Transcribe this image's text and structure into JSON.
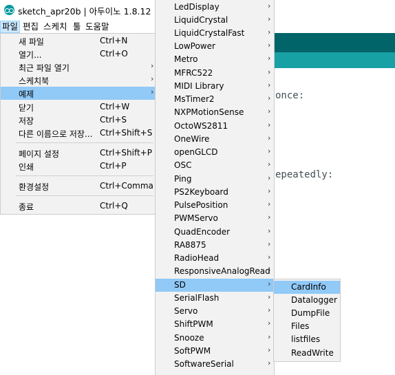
{
  "window": {
    "title": "sketch_apr20b | 아두이노 1.8.12"
  },
  "menubar": {
    "items": [
      {
        "label": "파일",
        "active": true
      },
      {
        "label": "편집"
      },
      {
        "label": "스케치"
      },
      {
        "label": "툴"
      },
      {
        "label": "도움말"
      }
    ]
  },
  "file_menu": {
    "items": [
      {
        "label": "새 파일",
        "shortcut": "Ctrl+N"
      },
      {
        "label": "열기...",
        "shortcut": "Ctrl+O"
      },
      {
        "label": "최근 파일 열기",
        "submenu": true
      },
      {
        "label": "스케치북",
        "submenu": true
      },
      {
        "label": "예제",
        "submenu": true,
        "selected": true
      },
      {
        "label": "닫기",
        "shortcut": "Ctrl+W"
      },
      {
        "label": "저장",
        "shortcut": "Ctrl+S"
      },
      {
        "label": "다른 이름으로 저장...",
        "shortcut": "Ctrl+Shift+S"
      },
      {
        "label": "페이지 설정",
        "shortcut": "Ctrl+Shift+P"
      },
      {
        "label": "인쇄",
        "shortcut": "Ctrl+P"
      },
      {
        "label": "환경설정",
        "shortcut": "Ctrl+Comma"
      },
      {
        "label": "종료",
        "shortcut": "Ctrl+Q"
      }
    ]
  },
  "examples_menu": {
    "items": [
      {
        "label": "LedDisplay"
      },
      {
        "label": "LiquidCrystal"
      },
      {
        "label": "LiquidCrystalFast"
      },
      {
        "label": "LowPower"
      },
      {
        "label": "Metro"
      },
      {
        "label": "MFRC522"
      },
      {
        "label": "MIDI Library"
      },
      {
        "label": "MsTimer2"
      },
      {
        "label": "NXPMotionSense"
      },
      {
        "label": "OctoWS2811"
      },
      {
        "label": "OneWire"
      },
      {
        "label": "openGLCD"
      },
      {
        "label": "OSC"
      },
      {
        "label": "Ping"
      },
      {
        "label": "PS2Keyboard"
      },
      {
        "label": "PulsePosition"
      },
      {
        "label": "PWMServo"
      },
      {
        "label": "QuadEncoder"
      },
      {
        "label": "RA8875"
      },
      {
        "label": "RadioHead"
      },
      {
        "label": "ResponsiveAnalogRead"
      },
      {
        "label": "SD",
        "selected": true
      },
      {
        "label": "SerialFlash"
      },
      {
        "label": "Servo"
      },
      {
        "label": "ShiftPWM"
      },
      {
        "label": "Snooze"
      },
      {
        "label": "SoftPWM"
      },
      {
        "label": "SoftwareSerial"
      }
    ]
  },
  "sd_menu": {
    "items": [
      {
        "label": "CardInfo",
        "selected": true
      },
      {
        "label": "Datalogger"
      },
      {
        "label": "DumpFile"
      },
      {
        "label": "Files"
      },
      {
        "label": "listfiles"
      },
      {
        "label": "ReadWrite"
      }
    ]
  },
  "editor": {
    "code_fragments": [
      "once:",
      "epeatedly:"
    ]
  },
  "colors": {
    "toolbar": "#006468",
    "tabs": "#17a1a5",
    "menu_bg": "#f2f2f2",
    "menu_selected": "#91c9f7",
    "menubar_active": "#cce8ff"
  }
}
